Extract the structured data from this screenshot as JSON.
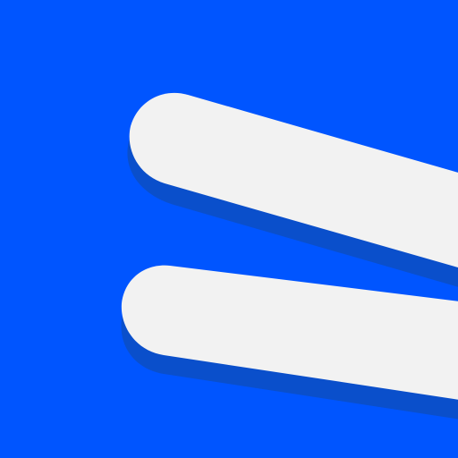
{
  "app_icon": {
    "name": "two-stroke-logo-icon",
    "colors": {
      "background": "#0055ff",
      "stroke_fill": "#f2f2f2",
      "stroke_shadow": "#0a4fcb"
    }
  }
}
